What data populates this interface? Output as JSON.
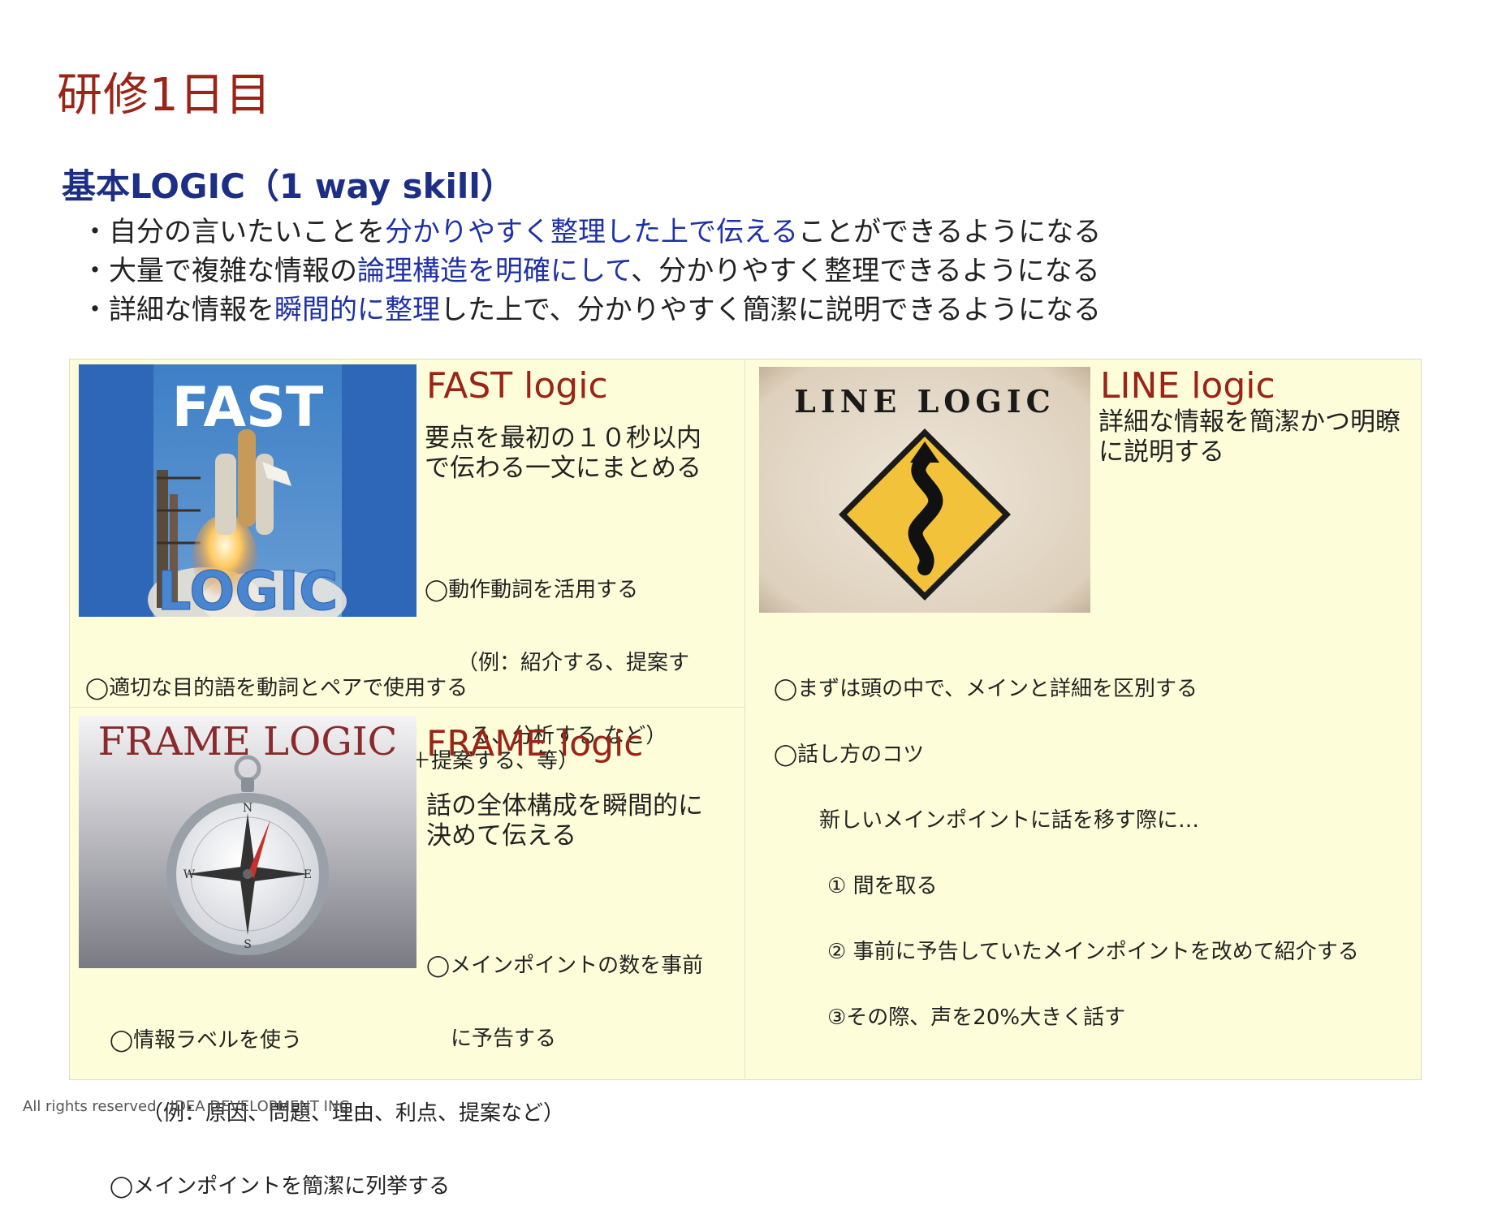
{
  "page_title": "研修1日目",
  "subtitle": "基本LOGIC（1 way skill）",
  "bullets": [
    {
      "pre": "・自分の言いたいことを",
      "hl": "分かりやすく整理した上で伝える",
      "post": "ことができるようになる"
    },
    {
      "pre": "・大量で複雑な情報の",
      "hl": "論理構造を明確にして",
      "post": "、分かりやすく整理できるようになる"
    },
    {
      "pre": "・詳細な情報を",
      "hl": "瞬間的に整理",
      "post": "した上で、分かりやすく簡潔に説明できるようになる"
    }
  ],
  "fast": {
    "image_text_top": "FAST",
    "image_text_bottom": "LOGIC",
    "title": "FAST logic",
    "desc_1": "要点を最初の１０秒以内",
    "desc_2": "で伝わる一文にまとめる",
    "note_a_1": "◯動作動詞を活用する",
    "note_a_2": "（例：紹介する、提案す",
    "note_a_3": "る、分析する など）",
    "note_b_1": "◯適切な目的語を動詞とペアで使用する",
    "note_b_2": "（例：新商品＋紹介する、解決策＋提案する、等）"
  },
  "frame": {
    "image_text": "FRAME LOGIC",
    "title": "FRAME logic",
    "desc_1": "話の全体構成を瞬間的に",
    "desc_2": "決めて伝える",
    "note_a_1": "◯メインポイントの数を事前",
    "note_a_2": "に予告する",
    "note_b_1": "◯情報ラベルを使う",
    "note_b_2": "（例：原因、問題、理由、利点、提案など）",
    "note_b_3": "◯メインポイントを簡潔に列挙する"
  },
  "line": {
    "image_text": "LINE LOGIC",
    "title": "LINE logic",
    "desc_1": "詳細な情報を簡潔かつ明瞭",
    "desc_2": "に説明する",
    "note_1": "◯まずは頭の中で、メインと詳細を区別する",
    "note_2": "◯話し方のコツ",
    "note_3": "新しいメインポイントに話を移す際に…",
    "note_4": "① 間を取る",
    "note_5": "② 事前に予告していたメインポイントを改めて紹介する",
    "note_6": "③その際、声を20%大きく話す"
  },
  "footer": "All rights reserved   IDEA DEVELOPMENT INC.",
  "colors": {
    "title_red": "#9b2418",
    "navy": "#1d2f85",
    "highlight_blue": "#1f31a6",
    "panel_bg": "#fdfed9"
  },
  "icons": [
    "rocket-launch-image",
    "compass-image",
    "winding-road-sign-image"
  ]
}
